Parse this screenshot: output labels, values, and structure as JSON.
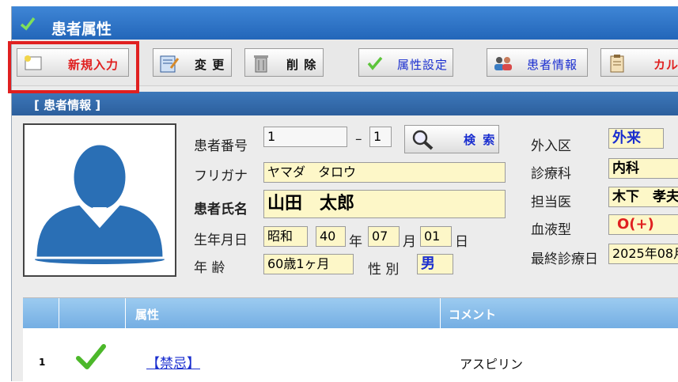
{
  "window": {
    "title": "患者属性"
  },
  "toolbar": {
    "new_label": "新規入力",
    "edit_label": "変 更",
    "delete_label": "削 除",
    "attr_label": "属性設定",
    "patient_info_label": "患者情報",
    "karte_label": "カル"
  },
  "section": {
    "title": "[ 患者情報 ]"
  },
  "patient": {
    "number_label": "患者番号",
    "number": "1",
    "dash": "–",
    "branch": "1",
    "search_label": "検 索",
    "kana_label": "フリガナ",
    "kana": "ヤマダ　タロウ",
    "name_label": "患者氏名",
    "name": "山田　太郎",
    "birth_label": "生年月日",
    "era": "昭和",
    "year": "40",
    "year_unit": "年",
    "month": "07",
    "month_unit": "月",
    "day": "01",
    "day_unit": "日",
    "age_label": "年 齢",
    "age": "60歳1ヶ月",
    "sex_label": "性 別",
    "sex": "男",
    "visit_label": "外入区",
    "visit": "外来",
    "dept_label": "診療科",
    "dept": "内科",
    "doctor_label": "担当医",
    "doctor": "木下　孝夫",
    "blood_label": "血液型",
    "blood": "O(+)",
    "last_visit_label": "最終診療日",
    "last_visit": "2025年08月"
  },
  "grid": {
    "headers": [
      "",
      "",
      "属性",
      "コメント"
    ],
    "rows": [
      {
        "no": "1",
        "attribute": "【禁忌】",
        "comment": "アスピリン"
      }
    ]
  },
  "colors": {
    "title_bar": "#2366b9",
    "accent_red": "#e02020",
    "link_blue": "#1a2ecf"
  }
}
